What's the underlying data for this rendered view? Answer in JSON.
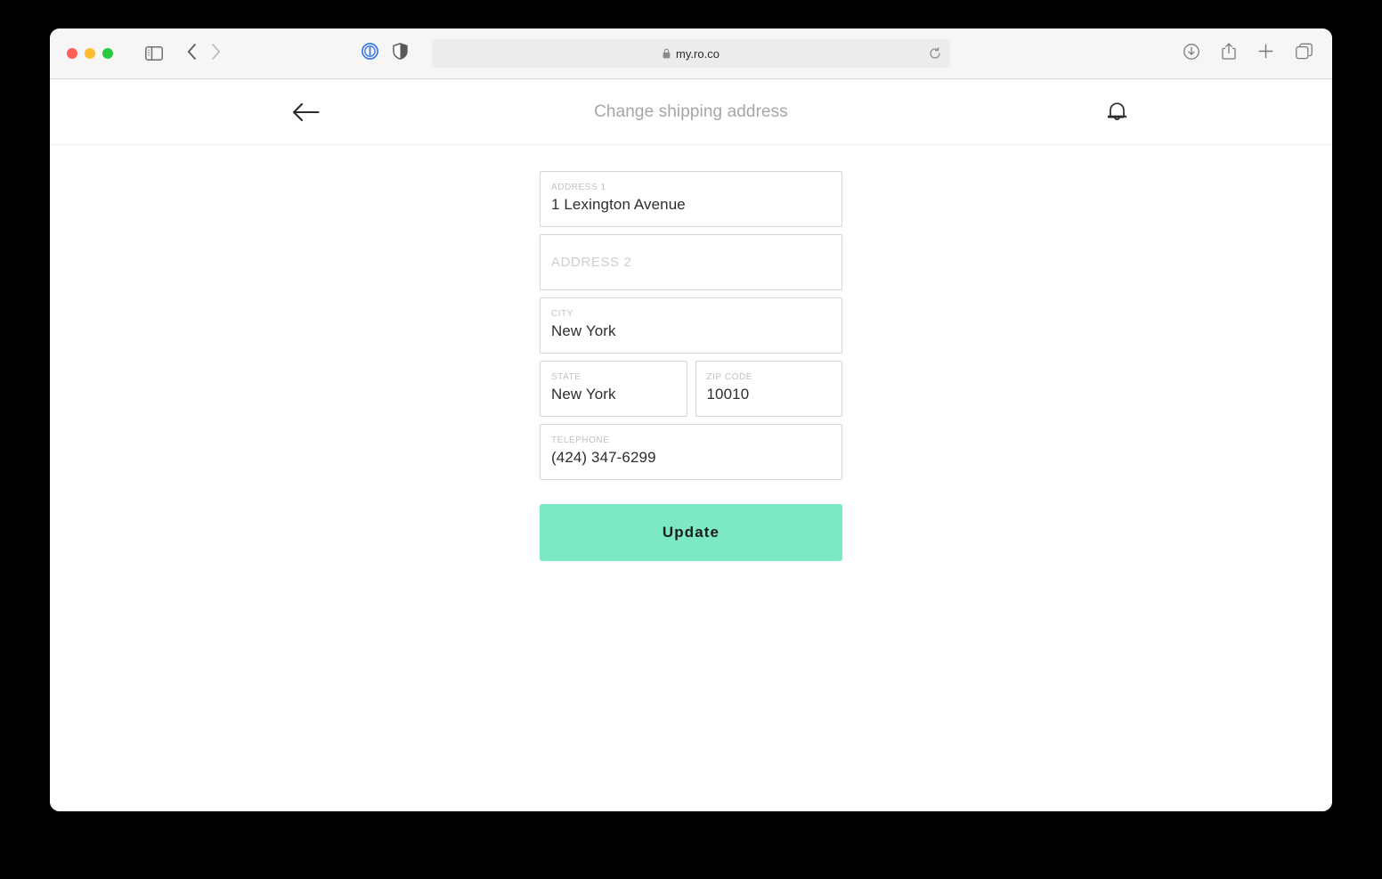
{
  "browser": {
    "url": "my.ro.co",
    "lock_icon": "lock-icon",
    "reload_icon": "reload-icon",
    "traffic_lights": {
      "close": "#ff5f57",
      "minimize": "#febc2e",
      "maximize": "#28c840"
    },
    "left_icons": [
      {
        "name": "sidebar-toggle-icon"
      },
      {
        "name": "back-navigation-icon"
      },
      {
        "name": "forward-navigation-icon"
      },
      {
        "name": "password-manager-icon"
      },
      {
        "name": "privacy-shield-icon"
      }
    ],
    "right_icons": [
      {
        "name": "downloads-icon"
      },
      {
        "name": "share-icon"
      },
      {
        "name": "new-tab-icon"
      },
      {
        "name": "tab-overview-icon"
      }
    ]
  },
  "page": {
    "header": {
      "back_icon": "arrow-left-icon",
      "title": "Change shipping address",
      "bell_icon": "bell-icon"
    },
    "form": {
      "fields": [
        {
          "label": "ADDRESS 1",
          "value": "1 Lexington Avenue",
          "placeholder": "ADDRESS 1",
          "empty": false
        },
        {
          "label": "ADDRESS 2",
          "value": "",
          "placeholder": "ADDRESS 2",
          "empty": true
        },
        {
          "label": "CITY",
          "value": "New York",
          "placeholder": "CITY",
          "empty": false
        },
        {
          "label": "STATE",
          "value": "New York",
          "placeholder": "STATE",
          "empty": false
        },
        {
          "label": "ZIP CODE",
          "value": "10010",
          "placeholder": "ZIP CODE",
          "empty": false
        },
        {
          "label": "TELEPHONE",
          "value": "(424) 347-6299",
          "placeholder": "TELEPHONE",
          "empty": false
        }
      ],
      "submit_label": "Update",
      "submit_color": "#7ce8c6"
    }
  }
}
